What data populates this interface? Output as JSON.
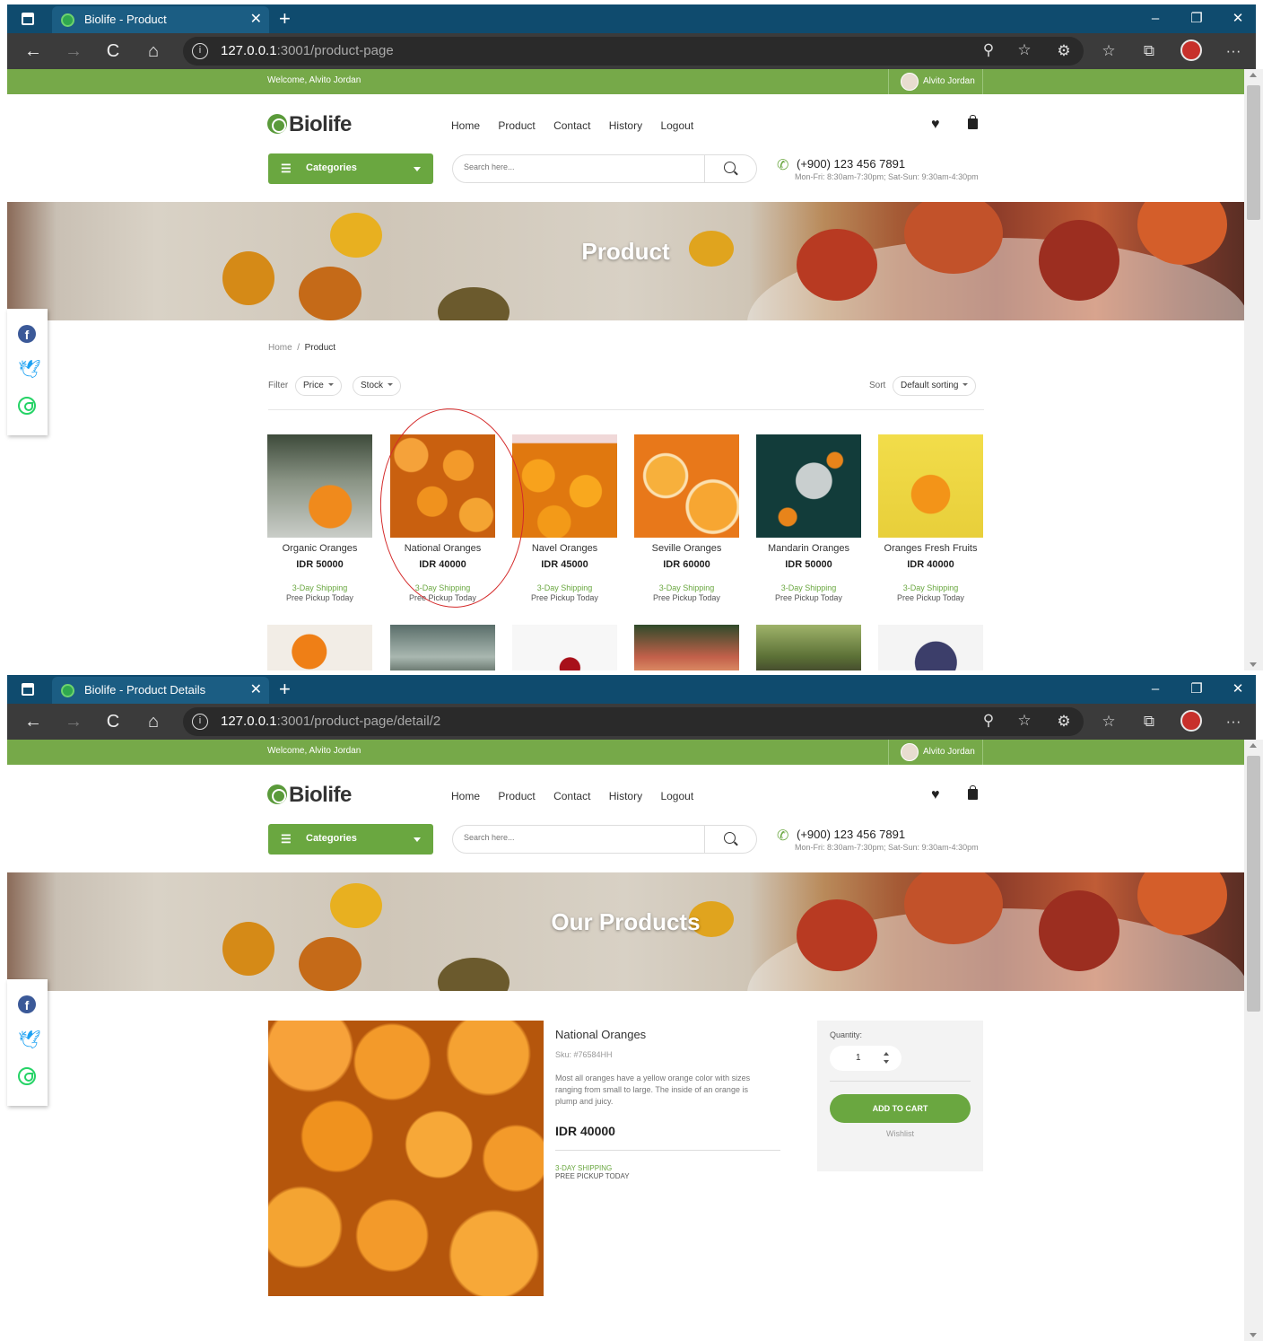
{
  "browser": {
    "new_tab": "+",
    "minimize": "–",
    "restore": "❐",
    "close": "✕",
    "back": "←",
    "forward": "→",
    "reload": "C",
    "home": "⌂",
    "more": "···"
  },
  "shot1": {
    "tab_title": "Biolife - Product",
    "url_host": "127.0.0.1",
    "url_rest": ":3001/product-page",
    "banner_title": "Product"
  },
  "shot2": {
    "tab_title": "Biolife - Product Details",
    "url_host": "127.0.0.1",
    "url_rest": ":3001/product-page/detail/2",
    "banner_title": "Our Products"
  },
  "site": {
    "welcome": "Welcome, Alvito Jordan",
    "user_name": "Alvito Jordan",
    "logo": "Biolife",
    "menu": [
      "Home",
      "Product",
      "Contact",
      "History",
      "Logout"
    ],
    "categories_label": "Categories",
    "search_placeholder": "Search here...",
    "phone": "(+900) 123 456 7891",
    "hours": "Mon-Fri: 8:30am-7:30pm; Sat-Sun: 9:30am-4:30pm",
    "accent_color": "#76a949"
  },
  "listing": {
    "breadcrumb_home": "Home",
    "breadcrumb_sep": "/",
    "breadcrumb_current": "Product",
    "filter_label": "Filter",
    "price_label": "Price",
    "stock_label": "Stock",
    "sort_label": "Sort",
    "sort_value": "Default sorting",
    "products": [
      {
        "name": "Organic Oranges",
        "price": "IDR 50000",
        "shipping": "3-Day Shipping",
        "pickup": "Pree Pickup Today"
      },
      {
        "name": "National Oranges",
        "price": "IDR 40000",
        "shipping": "3-Day Shipping",
        "pickup": "Pree Pickup Today"
      },
      {
        "name": "Navel Oranges",
        "price": "IDR 45000",
        "shipping": "3-Day Shipping",
        "pickup": "Pree Pickup Today"
      },
      {
        "name": "Seville Oranges",
        "price": "IDR 60000",
        "shipping": "3-Day Shipping",
        "pickup": "Pree Pickup Today"
      },
      {
        "name": "Mandarin Oranges",
        "price": "IDR 50000",
        "shipping": "3-Day Shipping",
        "pickup": "Pree Pickup Today"
      },
      {
        "name": "Oranges Fresh Fruits",
        "price": "IDR 40000",
        "shipping": "3-Day Shipping",
        "pickup": "Pree Pickup Today"
      }
    ]
  },
  "detail": {
    "name": "National Oranges",
    "sku": "Sku: #76584HH",
    "description": "Most all oranges have a yellow orange color with sizes ranging from small to large. The inside of an orange is plump and juicy.",
    "price": "IDR 40000",
    "shipping": "3-DAY SHIPPING",
    "pickup": "PREE PICKUP TODAY",
    "quantity_label": "Quantity:",
    "quantity": "1",
    "add_to_cart": "ADD TO CART",
    "wishlist": "Wishlist"
  }
}
